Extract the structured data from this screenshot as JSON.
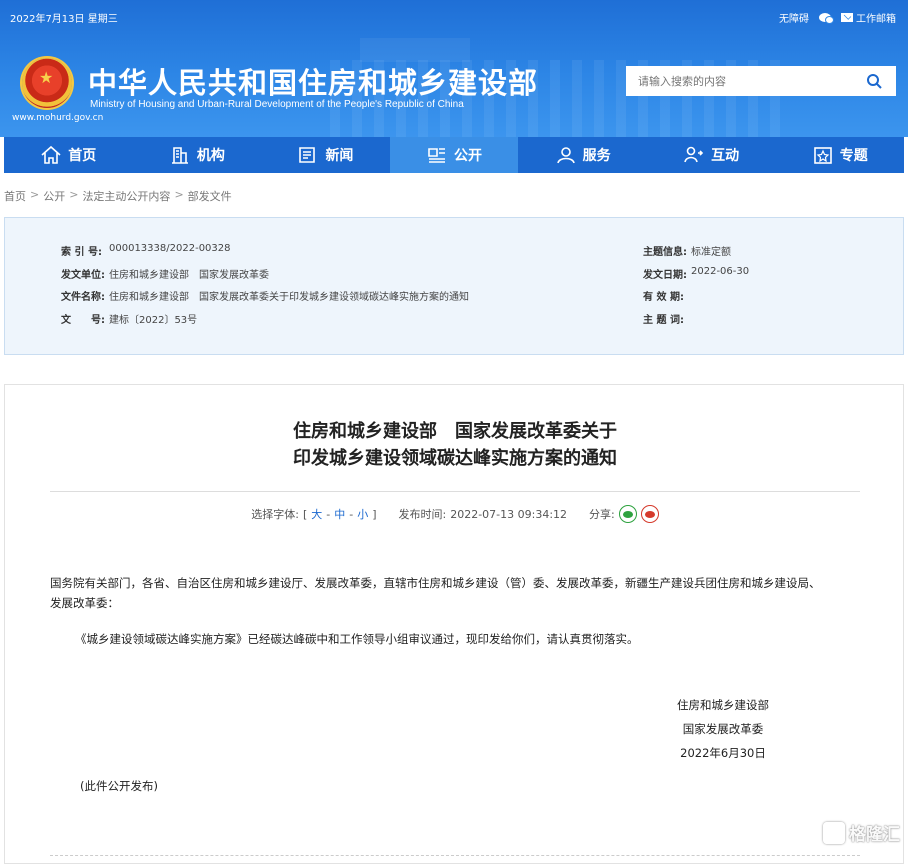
{
  "header": {
    "date": "2022年7月13日 星期三",
    "links": {
      "accessible": "无障碍",
      "work_email": "工作邮箱"
    },
    "title": "中华人民共和国住房和城乡建设部",
    "subtitle": "Ministry of Housing and Urban-Rural Development of the People's Republic of China",
    "url": "www.mohurd.gov.cn",
    "search_placeholder": "请输入搜索的内容"
  },
  "nav": {
    "items": [
      {
        "label": "首页",
        "icon": "home-icon"
      },
      {
        "label": "机构",
        "icon": "building-icon"
      },
      {
        "label": "新闻",
        "icon": "news-icon"
      },
      {
        "label": "公开",
        "icon": "open-icon",
        "active": true
      },
      {
        "label": "服务",
        "icon": "service-icon"
      },
      {
        "label": "互动",
        "icon": "interact-icon"
      },
      {
        "label": "专题",
        "icon": "topic-icon"
      }
    ]
  },
  "breadcrumb": [
    "首页",
    "公开",
    "法定主动公开内容",
    "部发文件"
  ],
  "info": {
    "index_no_k": "索 引 号:",
    "index_no_v": "000013338/2022-00328",
    "issuer_k": "发文单位:",
    "issuer_v": "住房和城乡建设部　国家发展改革委",
    "doc_name_k": "文件名称:",
    "doc_name_v": "住房和城乡建设部　国家发展改革委关于印发城乡建设领域碳达峰实施方案的通知",
    "doc_no_k": "文　　号:",
    "doc_no_v": "建标〔2022〕53号",
    "topic_k": "主题信息:",
    "topic_v": "标准定额",
    "date_k": "发文日期:",
    "date_v": "2022-06-30",
    "valid_k": "有 效 期:",
    "valid_v": "",
    "keywords_k": "主 题 词:",
    "keywords_v": ""
  },
  "article": {
    "title_line1": "住房和城乡建设部　国家发展改革委关于",
    "title_line2": "印发城乡建设领域碳达峰实施方案的通知",
    "font_label": "选择字体:",
    "font_open": "[",
    "font_large": "大",
    "font_medium": "中",
    "font_small": "小",
    "font_close": "]",
    "dash1": "-",
    "dash2": "-",
    "publish_label": "发布时间:",
    "publish_time": "2022-07-13 09:34:12",
    "share_label": "分享:",
    "para1_line1": "国务院有关部门，各省、自治区住房和城乡建设厅、发展改革委，直辖市住房和城乡建设（管）委、发展改革委，新疆生产建设兵团住房和城乡建设局、",
    "para1_line2": "发展改革委：",
    "para2": "《城乡建设领域碳达峰实施方案》已经碳达峰碳中和工作领导小组审议通过，现印发给你们，请认真贯彻落实。",
    "sign1": "住房和城乡建设部",
    "sign2": "国家发展改革委",
    "sign3": "2022年6月30日",
    "note": "(此件公开发布)"
  },
  "watermark": "格隆汇"
}
